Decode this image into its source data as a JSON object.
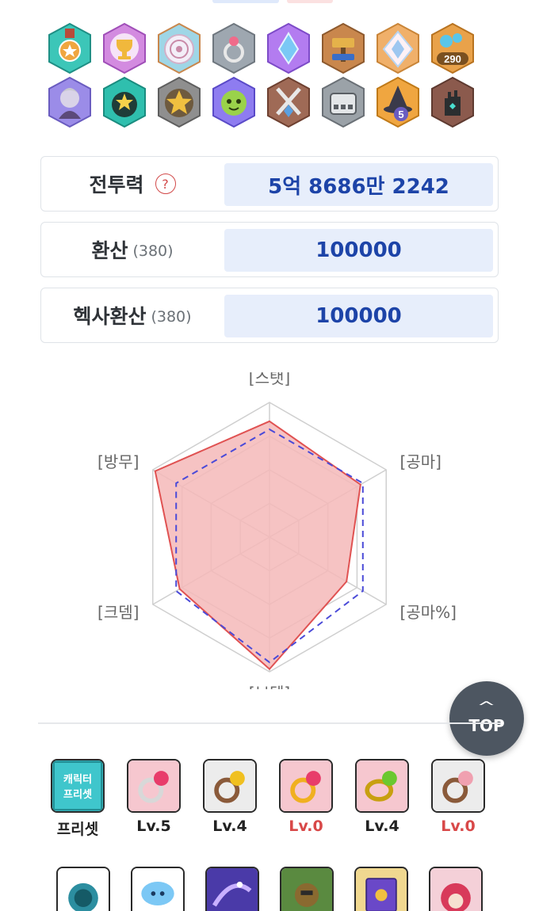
{
  "badges": [
    {
      "icon": "medal-icon",
      "color": "#3cc6b8"
    },
    {
      "icon": "trophy-icon",
      "color": "#d38be0"
    },
    {
      "icon": "target-icon",
      "color": "#9fd6e6"
    },
    {
      "icon": "ring-icon",
      "color": "#9ea7b0"
    },
    {
      "icon": "crystal-icon",
      "color": "#b37cf0"
    },
    {
      "icon": "hammer-icon",
      "color": "#c9874d"
    },
    {
      "icon": "diamond-icon",
      "color": "#f0b06a"
    },
    {
      "icon": "coin-290-icon",
      "color": "#e9a24a",
      "text": "290"
    },
    {
      "icon": "character-portrait-icon",
      "color": "#9b8ce8"
    },
    {
      "icon": "star-character-icon",
      "color": "#2fbfae"
    },
    {
      "icon": "gold-star-icon",
      "color": "#8f8f8f"
    },
    {
      "icon": "green-slime-icon",
      "color": "#8e7cf0"
    },
    {
      "icon": "crossed-swords-icon",
      "color": "#9f6a56"
    },
    {
      "icon": "armor-icon",
      "color": "#9ba2a8"
    },
    {
      "icon": "witch-hat-5-icon",
      "color": "#f0a640",
      "text": "5"
    },
    {
      "icon": "dark-hand-icon",
      "color": "#8b5a4d"
    }
  ],
  "stats": {
    "combat_power": {
      "label": "전투력",
      "value": "5억 8686만 2242"
    },
    "conversion": {
      "label": "환산",
      "sub": "(380)",
      "value": "100000"
    },
    "hexa_conversion": {
      "label": "헥사환산",
      "sub": "(380)",
      "value": "100000"
    }
  },
  "chart_data": {
    "type": "radar",
    "axes": [
      "[스탯]",
      "[공마]",
      "[공마%]",
      "[보뎀]",
      "[크뎀]",
      "[방무]"
    ],
    "series": [
      {
        "values": [
          0.86,
          0.78,
          0.66,
          0.98,
          0.77,
          0.98
        ],
        "color": "#e05252",
        "fill": "#f5b8b8"
      },
      {
        "values": [
          0.8,
          0.8,
          0.8,
          0.93,
          0.8,
          0.8
        ],
        "color": "#4a4ad8",
        "dashed": true
      }
    ],
    "grid_levels": 4,
    "range": [
      0,
      1
    ]
  },
  "top_button": {
    "label": "TOP"
  },
  "equipment_row1": [
    {
      "icon": "character-preset-icon",
      "label": "프리셋",
      "icon_text": "캐릭터 프리셋",
      "red": false
    },
    {
      "icon": "ruby-ring-icon",
      "label": "Lv.5",
      "red": false
    },
    {
      "icon": "gold-gem-ring-icon",
      "label": "Lv.4",
      "red": false
    },
    {
      "icon": "gold-ruby-ring-icon",
      "label": "Lv.0",
      "red": true
    },
    {
      "icon": "green-ring-icon",
      "label": "Lv.4",
      "red": false
    },
    {
      "icon": "pink-gem-ring-icon",
      "label": "Lv.0",
      "red": true
    }
  ],
  "equipment_row2": [
    {
      "icon": "blue-spirit-icon"
    },
    {
      "icon": "blue-mushroom-icon"
    },
    {
      "icon": "galaxy-icon"
    },
    {
      "icon": "knight-icon"
    },
    {
      "icon": "spellbook-icon"
    },
    {
      "icon": "red-hair-character-icon"
    }
  ]
}
